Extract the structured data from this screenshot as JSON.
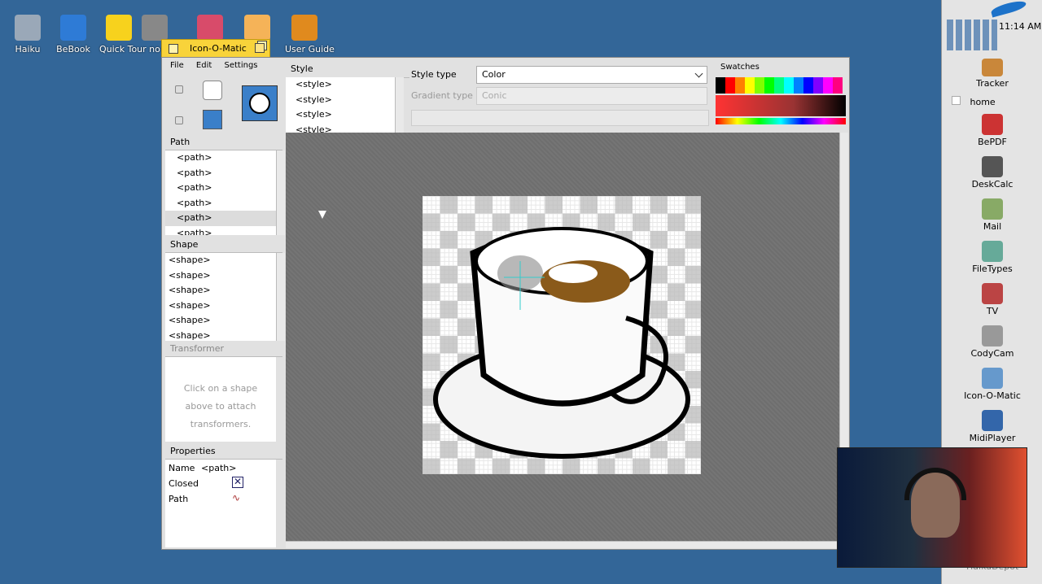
{
  "desktop": {
    "icons": [
      {
        "label": "Haiku",
        "icon": "haiku-drive-icon",
        "color": "#9aa8b8"
      },
      {
        "label": "BeBook",
        "icon": "globe-book-icon",
        "color": "#2e7bd6"
      },
      {
        "label": "Quick Tour",
        "icon": "lightbulb-icon",
        "color": "#f7d21d"
      },
      {
        "label": "no",
        "icon": "document-icon",
        "color": "#888"
      },
      {
        "label": "",
        "icon": "gift-icon",
        "color": "#d84b6a"
      },
      {
        "label": "",
        "icon": "folder-icon",
        "color": "#f5b358"
      },
      {
        "label": "User Guide",
        "icon": "guide-book-icon",
        "color": "#e08a1e"
      }
    ]
  },
  "window": {
    "title": "Icon-O-Matic",
    "menu": [
      "File",
      "Edit",
      "Settings"
    ],
    "style_header": "Style",
    "style_items": [
      "<style>",
      "<style>",
      "<style>",
      "<style>"
    ],
    "style_type_label": "Style type",
    "style_type_value": "Color",
    "gradient_label": "Gradient type",
    "gradient_value": "Conic",
    "swatches_label": "Swatches",
    "swatch_colors": [
      "#000000",
      "#ff0000",
      "#ff8000",
      "#ffff00",
      "#80ff00",
      "#00ff00",
      "#00ff80",
      "#00ffff",
      "#0080ff",
      "#0000ff",
      "#8000ff",
      "#ff00ff",
      "#ff0080"
    ],
    "path_header": "Path",
    "path_items": [
      "<path>",
      "<path>",
      "<path>",
      "<path>",
      "<path>",
      "<path>"
    ],
    "shape_header": "Shape",
    "shape_items": [
      "<shape>",
      "<shape>",
      "<shape>",
      "<shape>",
      "<shape>",
      "<shape>"
    ],
    "transformer_header": "Transformer",
    "transformer_hint": "Click on a shape above to attach transformers.",
    "properties_header": "Properties",
    "prop_name_label": "Name",
    "prop_name_value": "<path>",
    "prop_closed_label": "Closed",
    "prop_path_label": "Path"
  },
  "deskbar": {
    "time": "11:14 AM",
    "tracker": "Tracker",
    "home": "home",
    "apps": [
      {
        "label": "BePDF",
        "icon": "bepdf-icon",
        "color": "#c33"
      },
      {
        "label": "DeskCalc",
        "icon": "calculator-icon",
        "color": "#555"
      },
      {
        "label": "Mail",
        "icon": "mail-icon",
        "color": "#8a6"
      },
      {
        "label": "FileTypes",
        "icon": "filetypes-icon",
        "color": "#6a9"
      },
      {
        "label": "TV",
        "icon": "tv-icon",
        "color": "#b44"
      },
      {
        "label": "CodyCam",
        "icon": "webcam-icon",
        "color": "#999"
      },
      {
        "label": "Icon-O-Matic",
        "icon": "icon-o-matic-icon",
        "color": "#69c"
      },
      {
        "label": "MidiPlayer",
        "icon": "midi-icon",
        "color": "#36a"
      }
    ],
    "partial": "HaikuDepot"
  }
}
